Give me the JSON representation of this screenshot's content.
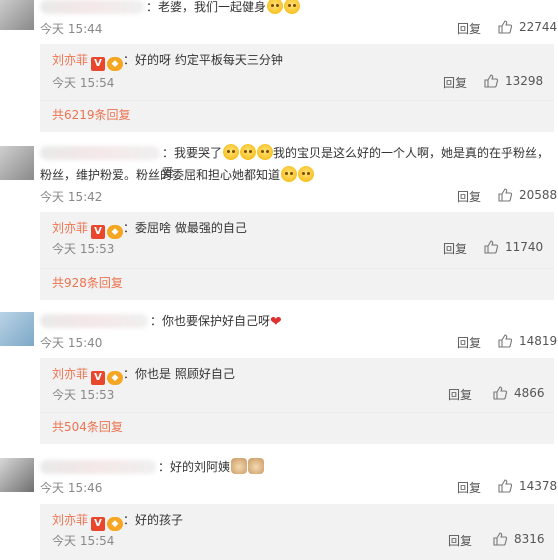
{
  "reply_label": "回复",
  "comments": [
    {
      "text": "：老婆，我们一起健身",
      "time": "今天 15:44",
      "likes": "22744",
      "reply": {
        "name": "刘亦菲",
        "text": "：好的呀 约定平板每天三分钟",
        "time": "今天 15:54",
        "likes": "13298"
      },
      "more": "共6219条回复"
    },
    {
      "text_a": "：我要哭了",
      "text_b": "我的宝贝是这么好的一个人啊，她是真的在乎粉丝，爱",
      "text_c": "粉丝，维护粉爱。粉丝的委屈和担心她都知道",
      "time": "今天 15:42",
      "likes": "20588",
      "reply": {
        "name": "刘亦菲",
        "text": "：委屈啥 做最强的自己",
        "time": "今天 15:53",
        "likes": "11740"
      },
      "more": "共928条回复"
    },
    {
      "text": "：你也要保护好自己呀",
      "time": "今天 15:40",
      "likes": "14819",
      "reply": {
        "name": "刘亦菲",
        "text": "：你也是 照顾好自己",
        "time": "今天 15:53",
        "likes": "4866"
      },
      "more": "共504条回复"
    },
    {
      "text": "：好的刘阿姨",
      "time": "今天 15:46",
      "likes": "14378",
      "reply": {
        "name": "刘亦菲",
        "text": "：好的孩子",
        "time": "今天 15:54",
        "likes": "8316"
      }
    }
  ],
  "icons": {
    "like": "thumbs-up-icon",
    "verified": "verified-v-badge-icon",
    "level": "vip-level-badge-icon",
    "emoji": "crying-emoji-icon",
    "heart": "red-heart-icon",
    "cat": "cat-face-emoji-icon"
  },
  "colors": {
    "name": "#eb7350",
    "verified": "#e8472d",
    "reply_bg": "#f2f2f2",
    "meta": "#888888"
  }
}
